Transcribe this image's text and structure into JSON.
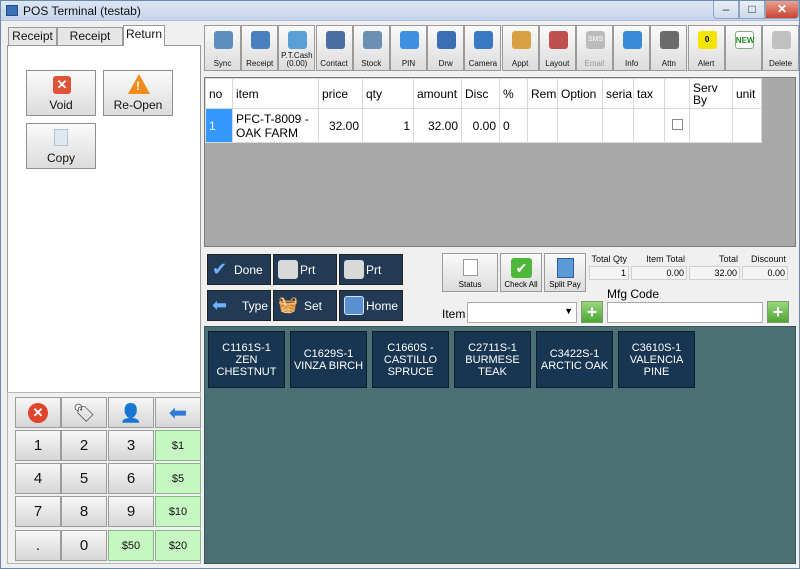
{
  "window": {
    "title": "POS Terminal (testab)",
    "minimize": "–",
    "maximize": "□",
    "close": "✕"
  },
  "tabs": [
    {
      "label": "Receipt"
    },
    {
      "label": "Receipt Info"
    },
    {
      "label": "Return"
    }
  ],
  "left_actions": {
    "void": "Void",
    "reopen": "Re-Open",
    "copy": "Copy"
  },
  "keypad": {
    "icons": [
      "cancel-icon",
      "price-tag-icon",
      "customer-icon",
      "backspace-arrow-icon"
    ],
    "keys": [
      "1",
      "2",
      "3",
      "4",
      "5",
      "6",
      "7",
      "8",
      "9",
      ".",
      "0"
    ],
    "money": [
      "$1",
      "$5",
      "$10",
      "$50",
      "$20"
    ]
  },
  "toolbar": [
    {
      "label": "Sync",
      "icon": "sync-icon"
    },
    {
      "label": "Receipt",
      "icon": "receipt-icon"
    },
    {
      "label": "P.T.Cash (0.00)",
      "icon": "pt-cash-icon"
    },
    {
      "label": "Contact",
      "icon": "contact-icon"
    },
    {
      "label": "Stock",
      "icon": "stock-icon"
    },
    {
      "label": "PIN",
      "icon": "pin-icon"
    },
    {
      "label": "Drw",
      "icon": "drawer-icon"
    },
    {
      "label": "Camera",
      "icon": "camera-icon"
    },
    {
      "label": "Appt",
      "icon": "appt-icon"
    },
    {
      "label": "Layout",
      "icon": "layout-icon"
    },
    {
      "label": "Email",
      "icon": "sms-email-icon",
      "sub": "SMS"
    },
    {
      "label": "Info",
      "icon": "info-icon"
    },
    {
      "label": "Attn",
      "icon": "attn-icon"
    },
    {
      "label": "Alert",
      "icon": "alert-icon",
      "badge": "0"
    },
    {
      "label": "",
      "icon": "new-icon",
      "badge": "NEW"
    },
    {
      "label": "Delete",
      "icon": "delete-icon"
    }
  ],
  "grid": {
    "columns": [
      "no",
      "item",
      "price",
      "qty",
      "amount",
      "Disc",
      "%",
      "Rema",
      "Option",
      "seria",
      "tax",
      "",
      "Serv By",
      "unit"
    ],
    "rows": [
      {
        "no": "1",
        "item": "PFC-T-8009 - OAK FARM",
        "price": "32.00",
        "qty": "1",
        "amount": "32.00",
        "disc": "0.00",
        "pct": "0"
      }
    ]
  },
  "actions": {
    "done": "Done",
    "prt_full": "Prt Full",
    "prt_item": "Prt Item",
    "type": "Type",
    "set": "Set",
    "home": "Home"
  },
  "status_buttons": {
    "status": "Status",
    "check_all": "Check All",
    "split_pay": "Split Pay"
  },
  "totals": {
    "labels": [
      "Total Qty",
      "Item Total",
      "Total",
      "Discount"
    ],
    "values": [
      "1",
      "0.00",
      "32.00",
      "0.00"
    ]
  },
  "item_field": {
    "label": "Item",
    "value": ""
  },
  "mfg_field": {
    "label": "Mfg Code",
    "value": ""
  },
  "products": [
    "C1161S-1 ZEN CHESTNUT",
    "C1629S-1 VINZA BIRCH",
    "C1660S - CASTILLO SPRUCE",
    "C2711S-1 BURMESE TEAK",
    "C3422S-1 ARCTIC OAK",
    "C3610S-1 VALENCIA PINE"
  ],
  "colors": {
    "accent": "#3399ff",
    "product_bg": "#183651",
    "panel_bg": "#4b6f73",
    "money_key": "#c6f7c2"
  }
}
